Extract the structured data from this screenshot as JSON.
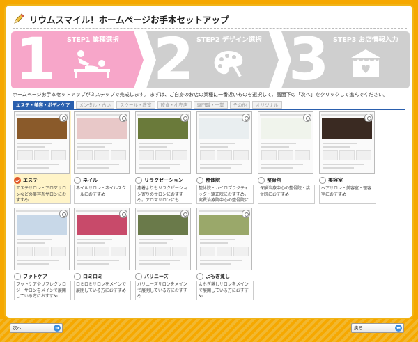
{
  "header": {
    "title": "リウムスマイル！ホームページお手本セットアップ"
  },
  "steps": [
    {
      "number": "1",
      "label": "STEP1 業種選択",
      "state": "active",
      "icon": "massage-icon"
    },
    {
      "number": "2",
      "label": "STEP2 デザイン選択",
      "state": "inactive",
      "icon": "palette-icon"
    },
    {
      "number": "3",
      "label": "STEP3 お店情報入力",
      "state": "inactive",
      "icon": "shop-icon"
    }
  ],
  "intro": "ホームページお手本セットアップが３ステップで完成します。 まずは、ご自身のお店の業種に一番近いものを選択して、画面下の「次へ」をクリックして進んでください。",
  "tabs": [
    {
      "label": "エステ・美容・ボディケア",
      "active": true
    },
    {
      "label": "メンタル・占い",
      "active": false
    },
    {
      "label": "スクール・教室",
      "active": false
    },
    {
      "label": "飲食・小売店",
      "active": false
    },
    {
      "label": "専門職・士業",
      "active": false
    },
    {
      "label": "その他",
      "active": false
    },
    {
      "label": "オリジナル",
      "active": false
    }
  ],
  "cards": [
    {
      "name": "エステ",
      "desc": "エステサロン・アロマサロンなどの美容系サロンにおすすめ",
      "selected": true,
      "hero": "#8a5a2a"
    },
    {
      "name": "ネイル",
      "desc": "ネイルサロン・ネイルスクールにおすすめ",
      "selected": false,
      "hero": "#e8c8c8"
    },
    {
      "name": "リラクゼーション",
      "desc": "癒着よりもリラクゼーション寄りのサロンにおすすめ。アロマサロンにも",
      "selected": false,
      "hero": "#6a7a3a"
    },
    {
      "name": "整体院",
      "desc": "整体院・カイロプラクティック・矯正院におすすめ。実費治療院中心の整骨院にも",
      "selected": false,
      "hero": "#e9eef0"
    },
    {
      "name": "整骨院",
      "desc": "保険治療中心の整骨院・接骨院におすすめ",
      "selected": false,
      "hero": "#f0f4ec"
    },
    {
      "name": "美容室",
      "desc": "ヘアサロン・美容室・理容室におすすめ",
      "selected": false,
      "hero": "#3a2a22"
    },
    {
      "name": "フットケア",
      "desc": "フットケアやリフレクソロジーサロンをメインで展開している方におすすめ",
      "selected": false,
      "hero": "#c8d8e8"
    },
    {
      "name": "ロミロミ",
      "desc": "ロミロミサロンをメインで展開している方におすすめ",
      "selected": false,
      "hero": "#c84a6a"
    },
    {
      "name": "バリニーズ",
      "desc": "バリニーズサロンをメインで展開している方におすすめ",
      "selected": false,
      "hero": "#6a7a4a"
    },
    {
      "name": "よもぎ蒸し",
      "desc": "よもぎ蒸しサロンをメインで展開している方におすすめ",
      "selected": false,
      "hero": "#9aa86a"
    }
  ],
  "footer": {
    "next_label": "次へ",
    "back_label": "戻る"
  },
  "colors": {
    "accent_pink": "#f7a6c9",
    "inactive_gray": "#cfcfcf",
    "tab_blue": "#2a5fae",
    "frame_orange": "#f6a800"
  }
}
